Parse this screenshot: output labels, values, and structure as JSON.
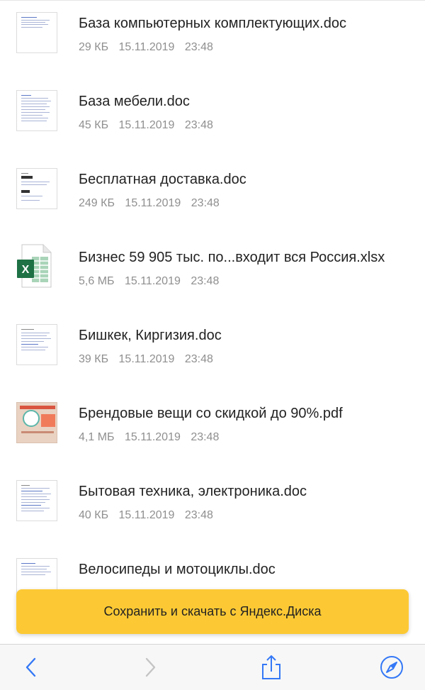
{
  "files": [
    {
      "name": "База компьютерных комплектующих.doc",
      "size": "29 КБ",
      "date": "15.11.2019",
      "time": "23:48",
      "type": "doc"
    },
    {
      "name": "База мебели.doc",
      "size": "45 КБ",
      "date": "15.11.2019",
      "time": "23:48",
      "type": "doc"
    },
    {
      "name": "Бесплатная доставка.doc",
      "size": "249 КБ",
      "date": "15.11.2019",
      "time": "23:48",
      "type": "doc"
    },
    {
      "name": "Бизнес 59 905 тыс. по...входит вся Россия.xlsx",
      "size": "5,6 МБ",
      "date": "15.11.2019",
      "time": "23:48",
      "type": "xlsx"
    },
    {
      "name": "Бишкек, Киргизия.doc",
      "size": "39 КБ",
      "date": "15.11.2019",
      "time": "23:48",
      "type": "doc"
    },
    {
      "name": "Брендовые вещи со скидкой до 90%.pdf",
      "size": "4,1 МБ",
      "date": "15.11.2019",
      "time": "23:48",
      "type": "pdf"
    },
    {
      "name": "Бытовая техника, электроника.doc",
      "size": "40 КБ",
      "date": "15.11.2019",
      "time": "23:48",
      "type": "doc"
    },
    {
      "name": "Велосипеды и мотоциклы.doc",
      "size": "",
      "date": "",
      "time": "",
      "type": "doc"
    }
  ],
  "save_button": {
    "label": "Сохранить и скачать с Яндекс.Диска"
  },
  "toolbar": {
    "back_icon": "chevron-left-icon",
    "forward_icon": "chevron-right-icon",
    "share_icon": "share-icon",
    "compass_icon": "compass-icon",
    "accent_color": "#3478f6",
    "disabled_color": "#c4c4c4"
  },
  "colors": {
    "button": "#fcc934",
    "excel": "#1e7145"
  }
}
